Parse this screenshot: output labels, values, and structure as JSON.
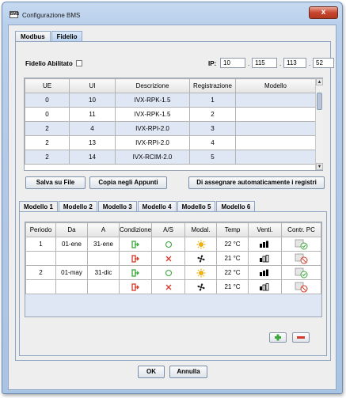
{
  "window": {
    "title": "Configurazione BMS",
    "close_glyph": "x",
    "app_icon_text": "BMS"
  },
  "top_tabs": [
    {
      "label": "Modbus"
    },
    {
      "label": "Fidelio"
    }
  ],
  "fidelio": {
    "enabled_label": "Fidelio Abilitato",
    "ip_label": "IP:",
    "ip": [
      "10",
      "115",
      "113",
      "52"
    ],
    "ip_dot": "."
  },
  "rooms_table": {
    "headers": [
      "UE",
      "UI",
      "Descrizione",
      "Registrazione",
      "Modello"
    ],
    "rows": [
      {
        "ue": "0",
        "ui": "10",
        "desc": "IVX-RPK-1.5",
        "reg": "1",
        "model": ""
      },
      {
        "ue": "0",
        "ui": "11",
        "desc": "IVX-RPK-1.5",
        "reg": "2",
        "model": ""
      },
      {
        "ue": "2",
        "ui": "4",
        "desc": "IVX-RPI-2.0",
        "reg": "3",
        "model": ""
      },
      {
        "ue": "2",
        "ui": "13",
        "desc": "IVX-RPI-2.0",
        "reg": "4",
        "model": ""
      },
      {
        "ue": "2",
        "ui": "14",
        "desc": "IVX-RCIM-2.0",
        "reg": "5",
        "model": ""
      }
    ]
  },
  "buttons": {
    "save_file": "Salva su File",
    "copy_clipboard": "Copia negli Appunti",
    "auto_assign": "Di assegnare automaticamente i registri",
    "ok": "OK",
    "cancel": "Annulla"
  },
  "model_tabs": [
    "Modello 1",
    "Modello 2",
    "Modello 3",
    "Modello 4",
    "Modello 5",
    "Modello 6"
  ],
  "schedule_table": {
    "headers": [
      "Periodo",
      "Da",
      "A",
      "Condizione",
      "A/S",
      "Modal.",
      "Temp",
      "Venti.",
      "Contr. PC"
    ],
    "rows": [
      {
        "periodo": "1",
        "da": "01-ene",
        "a": "31-ene",
        "cond": "in",
        "as": "on",
        "modal": "sun",
        "temp": "22 °C",
        "fan": 3,
        "pc": "allowed"
      },
      {
        "periodo": "",
        "da": "",
        "a": "",
        "cond": "out",
        "as": "off",
        "modal": "fan",
        "temp": "21 °C",
        "fan": 1,
        "pc": "forbidden"
      },
      {
        "periodo": "2",
        "da": "01-may",
        "a": "31-dic",
        "cond": "in",
        "as": "on",
        "modal": "sun",
        "temp": "22 °C",
        "fan": 3,
        "pc": "allowed"
      },
      {
        "periodo": "",
        "da": "",
        "a": "",
        "cond": "out",
        "as": "off",
        "modal": "fan",
        "temp": "21 °C",
        "fan": 1,
        "pc": "forbidden"
      }
    ]
  },
  "colors": {
    "green": "#3aa83a",
    "red": "#d23a2a",
    "sun": "#f4b400",
    "accent_row": "#dfe6f4"
  },
  "icons": {
    "add": "plus-icon",
    "remove": "minus-icon"
  }
}
